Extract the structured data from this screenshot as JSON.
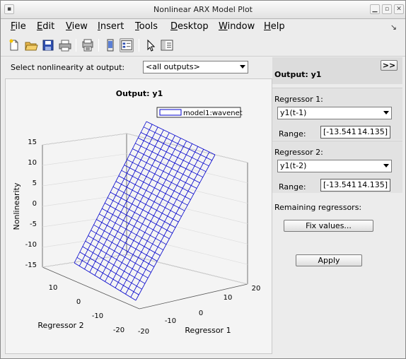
{
  "window": {
    "title": "Nonlinear ARX Model Plot"
  },
  "menu": [
    {
      "label": "File",
      "u": "F",
      "rest": "ile"
    },
    {
      "label": "Edit",
      "u": "E",
      "rest": "dit"
    },
    {
      "label": "View",
      "u": "V",
      "rest": "iew"
    },
    {
      "label": "Insert",
      "u": "I",
      "rest": "nsert"
    },
    {
      "label": "Tools",
      "u": "T",
      "rest": "ools"
    },
    {
      "label": "Desktop",
      "u": "D",
      "rest": "esktop"
    },
    {
      "label": "Window",
      "u": "W",
      "rest": "indow"
    },
    {
      "label": "Help",
      "u": "H",
      "rest": "elp"
    }
  ],
  "toolbar": {
    "icons": [
      "new-file-icon",
      "open-folder-icon",
      "save-icon",
      "print-icon",
      "print-preview-icon",
      "dock-figure-icon",
      "property-editor-icon",
      "pointer-icon",
      "plot-browser-icon"
    ]
  },
  "selector": {
    "label": "Select nonlinearity at output:",
    "value": "<all outputs>"
  },
  "plot": {
    "title": "Output: y1",
    "legend": "model1:wavenet",
    "zlabel": "Nonlinearity",
    "xlabel": "Regressor 1",
    "ylabel": "Regressor 2",
    "zticks": [
      "15",
      "10",
      "5",
      "0",
      "-5",
      "-10",
      "-15"
    ],
    "xticks": [
      "-20",
      "-10",
      "0",
      "10",
      "20"
    ],
    "yticks": [
      "-20",
      "-10",
      "0",
      "10"
    ],
    "line_color": "#0000cc"
  },
  "side": {
    "collapse_button": ">>",
    "title": "Output: y1",
    "regressor1": {
      "label": "Regressor 1:",
      "value": "y1(t-1)",
      "range_label": "Range:",
      "range_low": "[-13.541",
      "range_high": "14.135]"
    },
    "regressor2": {
      "label": "Regressor 2:",
      "value": "y1(t-2)",
      "range_label": "Range:",
      "range_low": "[-13.541",
      "range_high": "14.135]"
    },
    "remaining_label": "Remaining regressors:",
    "fix_button": "Fix values...",
    "apply_button": "Apply"
  }
}
